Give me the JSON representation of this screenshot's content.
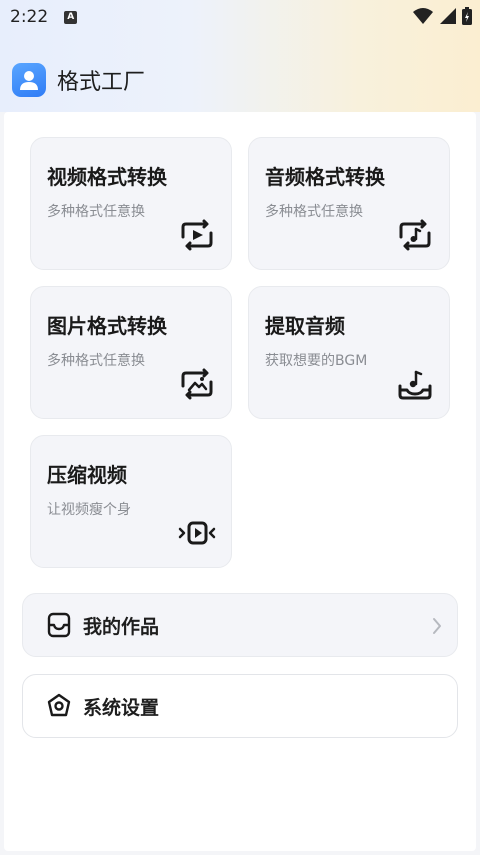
{
  "status_bar": {
    "time": "2:22",
    "notif_letter": "A"
  },
  "header": {
    "app_title": "格式工厂",
    "logo_icon": "user-icon"
  },
  "cards": [
    {
      "title": "视频格式转换",
      "subtitle": "多种格式任意换",
      "icon": "video-convert-icon"
    },
    {
      "title": "音频格式转换",
      "subtitle": "多种格式任意换",
      "icon": "audio-convert-icon"
    },
    {
      "title": "图片格式转换",
      "subtitle": "多种格式任意换",
      "icon": "image-convert-icon"
    },
    {
      "title": "提取音频",
      "subtitle": "获取想要的BGM",
      "icon": "extract-audio-icon"
    },
    {
      "title": "压缩视频",
      "subtitle": "让视频瘦个身",
      "icon": "compress-video-icon"
    }
  ],
  "menu": {
    "works_label": "我的作品",
    "settings_label": "系统设置"
  },
  "colors": {
    "accent": "#2f7cf6",
    "card_bg": "#f4f5f9",
    "text_primary": "#1a1a1a",
    "text_secondary": "#8a8d93"
  }
}
